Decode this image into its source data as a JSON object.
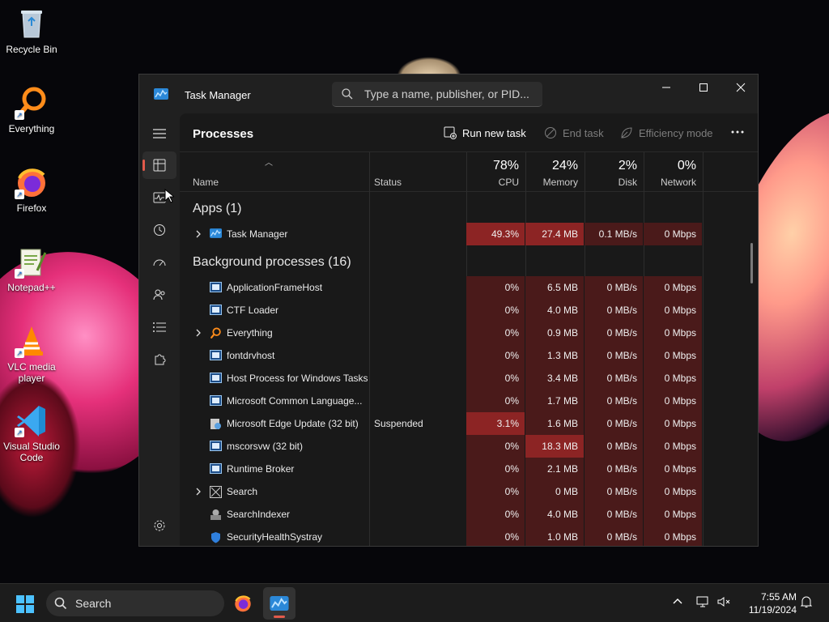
{
  "desktop": {
    "icons": [
      {
        "label": "Recycle Bin",
        "icon": "recycle-bin-icon"
      },
      {
        "label": "Everything",
        "icon": "everything-search-icon"
      },
      {
        "label": "Firefox",
        "icon": "firefox-icon"
      },
      {
        "label": "Notepad++",
        "icon": "notepadpp-icon"
      },
      {
        "label": "VLC media player",
        "icon": "vlc-icon"
      },
      {
        "label": "Visual Studio Code",
        "icon": "vscode-icon"
      }
    ]
  },
  "window": {
    "title": "Task Manager",
    "search_placeholder": "Type a name, publisher, or PID..."
  },
  "commandbar": {
    "page_title": "Processes",
    "run_new_task": "Run new task",
    "end_task": "End task",
    "efficiency_mode": "Efficiency mode"
  },
  "columns": {
    "name": "Name",
    "status": "Status",
    "cpu": {
      "pct": "78%",
      "label": "CPU"
    },
    "memory": {
      "pct": "24%",
      "label": "Memory"
    },
    "disk": {
      "pct": "2%",
      "label": "Disk"
    },
    "network": {
      "pct": "0%",
      "label": "Network"
    }
  },
  "groups": {
    "apps": "Apps (1)",
    "background": "Background processes (16)"
  },
  "apps": [
    {
      "name": "Task Manager",
      "status": "",
      "cpu": "49.3%",
      "memory": "27.4 MB",
      "disk": "0.1 MB/s",
      "network": "0 Mbps"
    }
  ],
  "background": [
    {
      "name": "ApplicationFrameHost",
      "status": "",
      "cpu": "0%",
      "memory": "6.5 MB",
      "disk": "0 MB/s",
      "network": "0 Mbps"
    },
    {
      "name": "CTF Loader",
      "status": "",
      "cpu": "0%",
      "memory": "4.0 MB",
      "disk": "0 MB/s",
      "network": "0 Mbps"
    },
    {
      "name": "Everything",
      "status": "",
      "cpu": "0%",
      "memory": "0.9 MB",
      "disk": "0 MB/s",
      "network": "0 Mbps"
    },
    {
      "name": "fontdrvhost",
      "status": "",
      "cpu": "0%",
      "memory": "1.3 MB",
      "disk": "0 MB/s",
      "network": "0 Mbps"
    },
    {
      "name": "Host Process for Windows Tasks",
      "status": "",
      "cpu": "0%",
      "memory": "3.4 MB",
      "disk": "0 MB/s",
      "network": "0 Mbps"
    },
    {
      "name": "Microsoft Common Language...",
      "status": "",
      "cpu": "0%",
      "memory": "1.7 MB",
      "disk": "0 MB/s",
      "network": "0 Mbps"
    },
    {
      "name": "Microsoft Edge Update (32 bit)",
      "status": "Suspended",
      "cpu": "3.1%",
      "memory": "1.6 MB",
      "disk": "0 MB/s",
      "network": "0 Mbps"
    },
    {
      "name": "mscorsvw (32 bit)",
      "status": "",
      "cpu": "0%",
      "memory": "18.3 MB",
      "disk": "0 MB/s",
      "network": "0 Mbps"
    },
    {
      "name": "Runtime Broker",
      "status": "",
      "cpu": "0%",
      "memory": "2.1 MB",
      "disk": "0 MB/s",
      "network": "0 Mbps"
    },
    {
      "name": "Search",
      "status": "",
      "cpu": "0%",
      "memory": "0 MB",
      "disk": "0 MB/s",
      "network": "0 Mbps"
    },
    {
      "name": "SearchIndexer",
      "status": "",
      "cpu": "0%",
      "memory": "4.0 MB",
      "disk": "0 MB/s",
      "network": "0 Mbps"
    },
    {
      "name": "SecurityHealthSystray",
      "status": "",
      "cpu": "0%",
      "memory": "1.0 MB",
      "disk": "0 MB/s",
      "network": "0 Mbps"
    }
  ],
  "taskbar": {
    "search_label": "Search",
    "time": "7:55 AM",
    "date": "11/19/2024"
  },
  "colors": {
    "heat_low": "#4a1a1a",
    "heat_mid": "#6e1f1f",
    "heat_high": "#8c2424",
    "accent": "#e25a4b"
  }
}
